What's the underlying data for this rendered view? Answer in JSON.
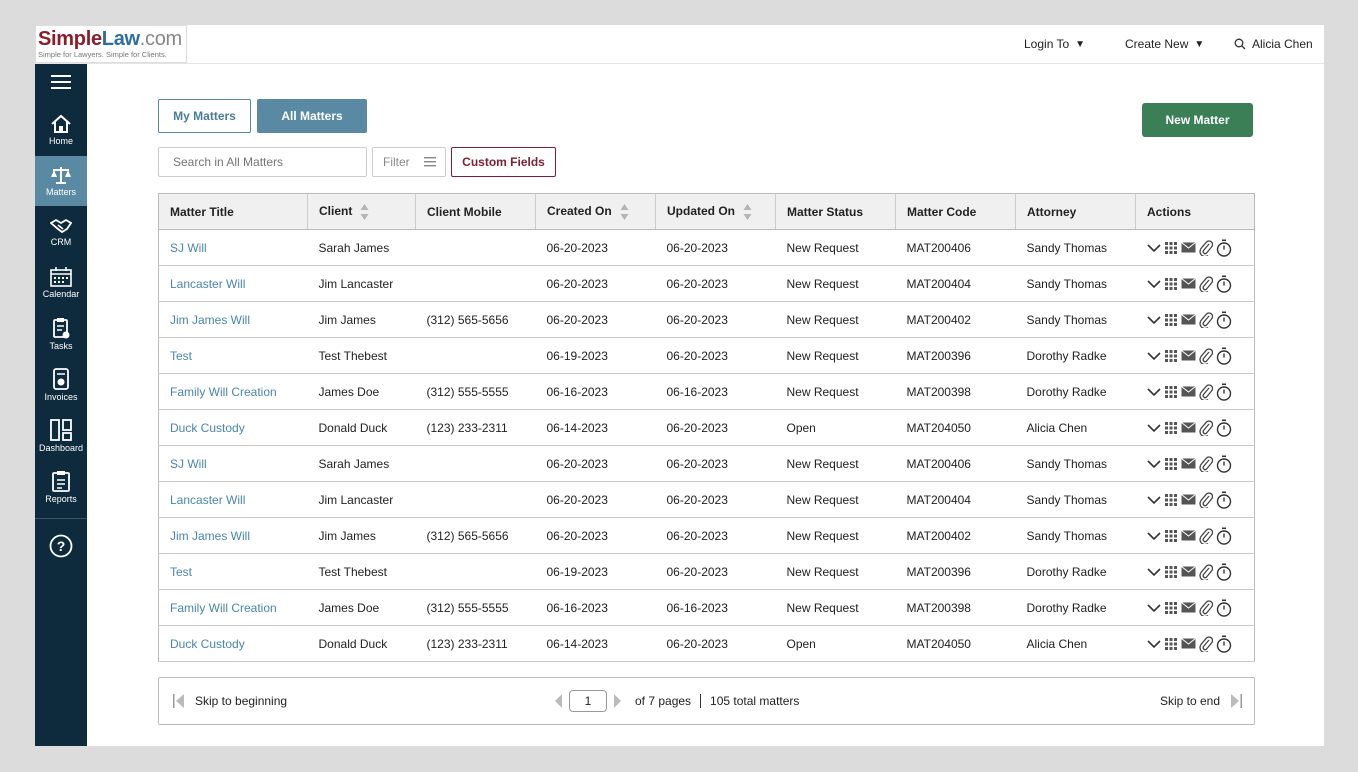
{
  "logo": {
    "part1": "Simple",
    "part2": "Law",
    "part3": ".com",
    "tagline": "Simple for Lawyers. Simple for Clients."
  },
  "topnav": {
    "login_to": "Login To",
    "create_new": "Create New",
    "user": "Alicia Chen"
  },
  "sidebar": {
    "items": [
      {
        "label": "Home",
        "icon": "home-icon"
      },
      {
        "label": "Matters",
        "icon": "scales-icon"
      },
      {
        "label": "CRM",
        "icon": "handshake-icon"
      },
      {
        "label": "Calendar",
        "icon": "calendar-icon"
      },
      {
        "label": "Tasks",
        "icon": "clipboard-icon"
      },
      {
        "label": "Invoices",
        "icon": "invoice-icon"
      },
      {
        "label": "Dashboard",
        "icon": "dashboard-icon"
      },
      {
        "label": "Reports",
        "icon": "report-icon"
      }
    ]
  },
  "tabs": {
    "my_matters": "My Matters",
    "all_matters": "All Matters"
  },
  "new_matter": "New Matter",
  "search": {
    "placeholder": "Search in All Matters"
  },
  "filter_label": "Filter",
  "custom_fields": "Custom Fields",
  "table": {
    "columns": [
      "Matter Title",
      "Client",
      "Client Mobile",
      "Created On",
      "Updated On",
      "Matter Status",
      "Matter Code",
      "Attorney",
      "Actions"
    ],
    "rows": [
      [
        "SJ Will",
        "Sarah James",
        "",
        "06-20-2023",
        "06-20-2023",
        "New Request",
        "MAT200406",
        "Sandy Thomas"
      ],
      [
        "Lancaster Will",
        "Jim Lancaster",
        "",
        "06-20-2023",
        "06-20-2023",
        "New Request",
        "MAT200404",
        "Sandy Thomas"
      ],
      [
        "Jim James Will",
        "Jim James",
        "(312) 565-5656",
        "06-20-2023",
        "06-20-2023",
        "New Request",
        "MAT200402",
        "Sandy Thomas"
      ],
      [
        "Test",
        "Test Thebest",
        "",
        "06-19-2023",
        "06-20-2023",
        "New Request",
        "MAT200396",
        "Dorothy Radke"
      ],
      [
        "Family Will Creation",
        "James Doe",
        "(312) 555-5555",
        "06-16-2023",
        "06-16-2023",
        "New Request",
        "MAT200398",
        "Dorothy Radke"
      ],
      [
        "Duck Custody",
        "Donald Duck",
        "(123) 233-2311",
        "06-14-2023",
        "06-20-2023",
        "Open",
        "MAT204050",
        "Alicia Chen"
      ],
      [
        "SJ Will",
        "Sarah James",
        "",
        "06-20-2023",
        "06-20-2023",
        "New Request",
        "MAT200406",
        "Sandy Thomas"
      ],
      [
        "Lancaster Will",
        "Jim Lancaster",
        "",
        "06-20-2023",
        "06-20-2023",
        "New Request",
        "MAT200404",
        "Sandy Thomas"
      ],
      [
        "Jim James Will",
        "Jim James",
        "(312) 565-5656",
        "06-20-2023",
        "06-20-2023",
        "New Request",
        "MAT200402",
        "Sandy Thomas"
      ],
      [
        "Test",
        "Test Thebest",
        "",
        "06-19-2023",
        "06-20-2023",
        "New Request",
        "MAT200396",
        "Dorothy Radke"
      ],
      [
        "Family Will Creation",
        "James Doe",
        "(312) 555-5555",
        "06-16-2023",
        "06-16-2023",
        "New Request",
        "MAT200398",
        "Dorothy Radke"
      ],
      [
        "Duck Custody",
        "Donald Duck",
        "(123) 233-2311",
        "06-14-2023",
        "06-20-2023",
        "Open",
        "MAT204050",
        "Alicia Chen"
      ]
    ]
  },
  "pager": {
    "skip_begin": "Skip to beginning",
    "page": "1",
    "of_pages": "of 7 pages",
    "total": "105 total matters",
    "skip_end": "Skip to end"
  },
  "colors": {
    "sidebar": "#0e2a3d",
    "active": "#5a8aa3",
    "new_matter": "#3b7f57",
    "custom_fields": "#7a1f36",
    "link": "#4a86ad"
  }
}
